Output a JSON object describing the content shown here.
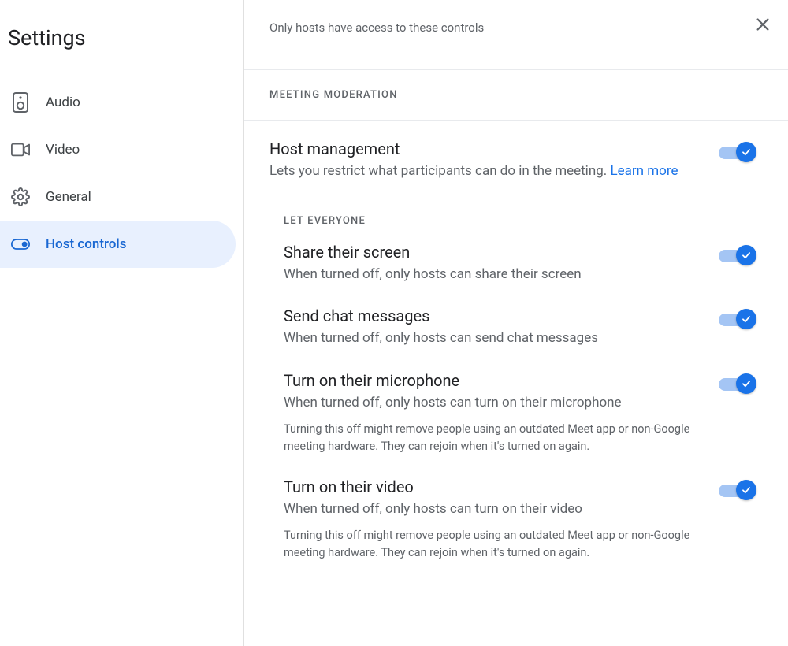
{
  "title": "Settings",
  "subtitle": "Only hosts have access to these controls",
  "sidebar": {
    "items": [
      {
        "label": "Audio"
      },
      {
        "label": "Video"
      },
      {
        "label": "General"
      },
      {
        "label": "Host controls"
      }
    ]
  },
  "section_heading": "MEETING MODERATION",
  "host_management": {
    "title": "Host management",
    "description": "Lets you restrict what participants can do in the meeting. ",
    "learn_more": "Learn more"
  },
  "let_everyone_heading": "LET EVERYONE",
  "options": [
    {
      "title": "Share their screen",
      "description": "When turned off, only hosts can share their screen",
      "note": ""
    },
    {
      "title": "Send chat messages",
      "description": "When turned off, only hosts can send chat messages",
      "note": ""
    },
    {
      "title": "Turn on their microphone",
      "description": "When turned off, only hosts can turn on their microphone",
      "note": "Turning this off might remove people using an outdated Meet app or non-Google meeting hardware. They can rejoin when it's turned on again."
    },
    {
      "title": "Turn on their video",
      "description": "When turned off, only hosts can turn on their video",
      "note": "Turning this off might remove people using an outdated Meet app or non-Google meeting hardware. They can rejoin when it's turned on again."
    }
  ]
}
